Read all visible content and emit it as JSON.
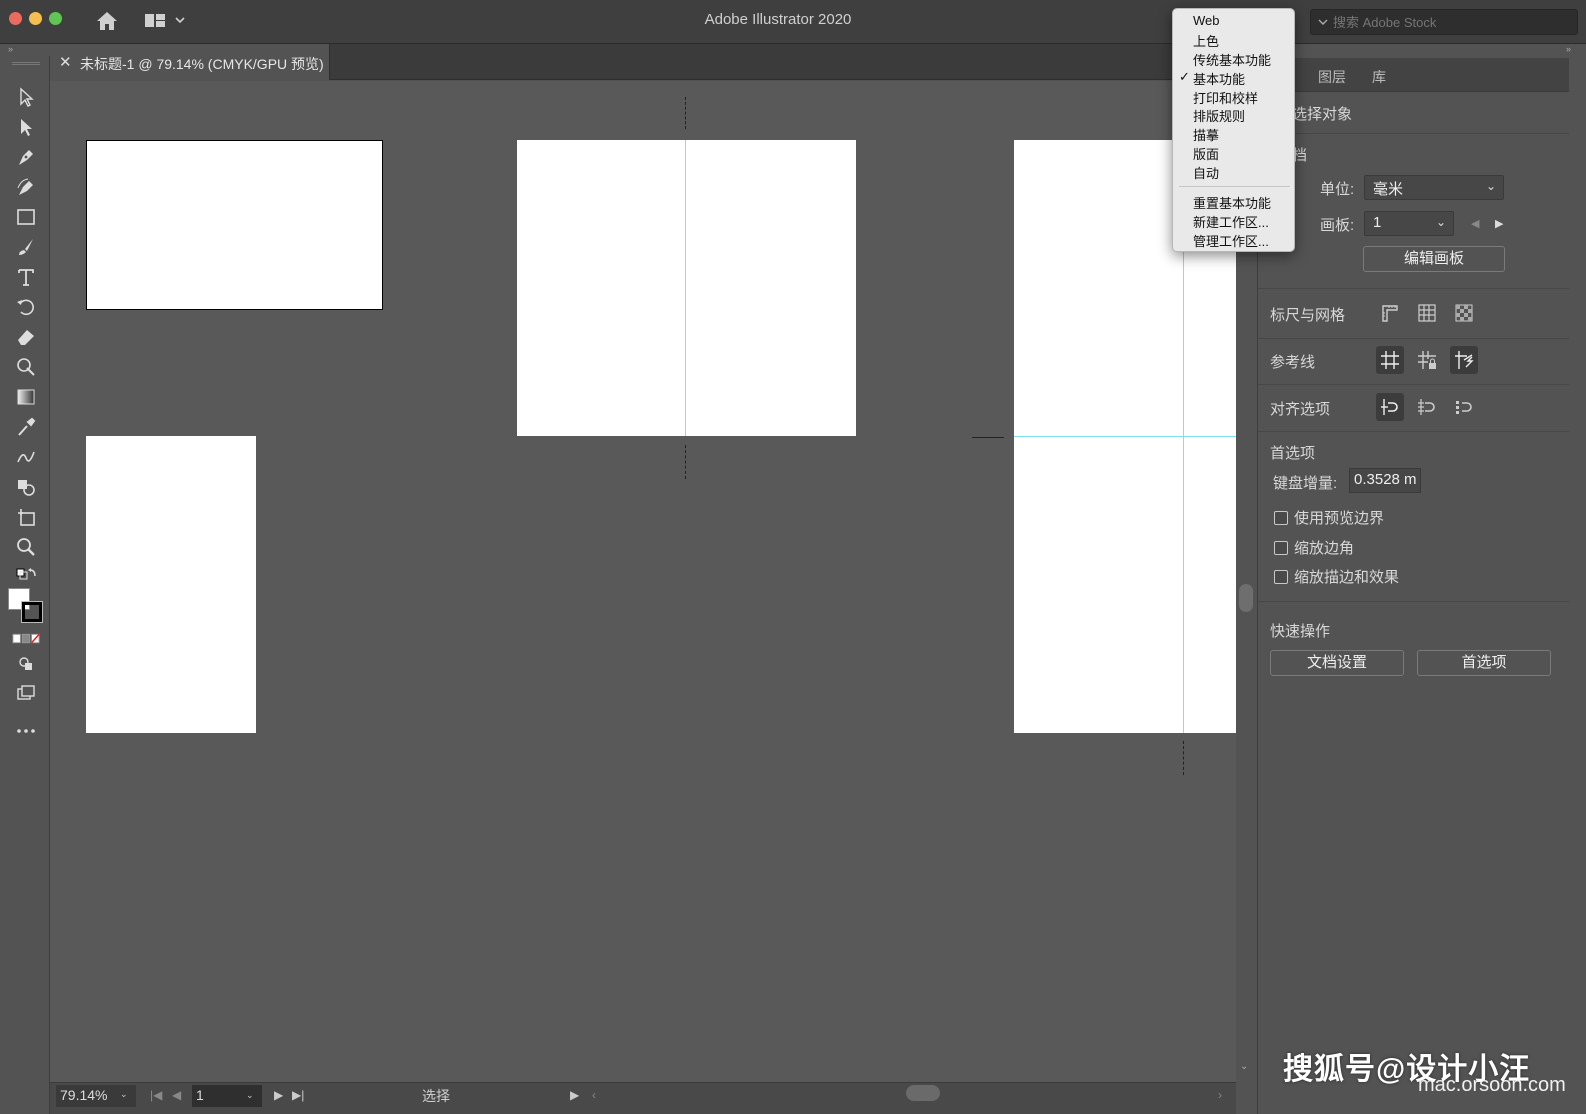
{
  "app": {
    "title": "Adobe Illustrator 2020",
    "search_placeholder": "搜索 Adobe Stock"
  },
  "document_tab": {
    "close": "✕",
    "label": "未标题-1 @ 79.14% (CMYK/GPU 预览)"
  },
  "workspace_menu": {
    "items": [
      "Web",
      "上色",
      "传统基本功能",
      "基本功能",
      "打印和校样",
      "排版规则",
      "描摹",
      "版面",
      "自动"
    ],
    "checked_index": 3,
    "check_mark": "✓",
    "actions": [
      "重置基本功能",
      "新建工作区...",
      "管理工作区..."
    ]
  },
  "panel": {
    "tabs": [
      "图层",
      "库"
    ],
    "no_selection": "选择对象",
    "section_artboard_partial": "档",
    "unit_label": "单位:",
    "unit_value": "毫米",
    "artboard_label": "画板:",
    "artboard_value": "1",
    "edit_artboard_button": "编辑画板",
    "rulers_grids_label": "标尺与网格",
    "guides_label": "参考线",
    "snap_options_label": "对齐选项",
    "preferences_title": "首选项",
    "keyboard_increment_label": "键盘增量:",
    "keyboard_increment_value": "0.3528 m",
    "checkboxes": [
      "使用预览边界",
      "缩放边角",
      "缩放描边和效果"
    ],
    "quick_actions_title": "快速操作",
    "doc_setup_button": "文档设置",
    "preferences_button": "首选项"
  },
  "status": {
    "zoom": "79.14%",
    "page": "1",
    "tool_label": "选择"
  },
  "watermark": {
    "line1": "搜狐号@设计小汪",
    "line2": "mac.orsoon.com"
  },
  "colors": {
    "guide": "#7ee0f0",
    "canvas": "#595959",
    "ui": "#535353"
  }
}
